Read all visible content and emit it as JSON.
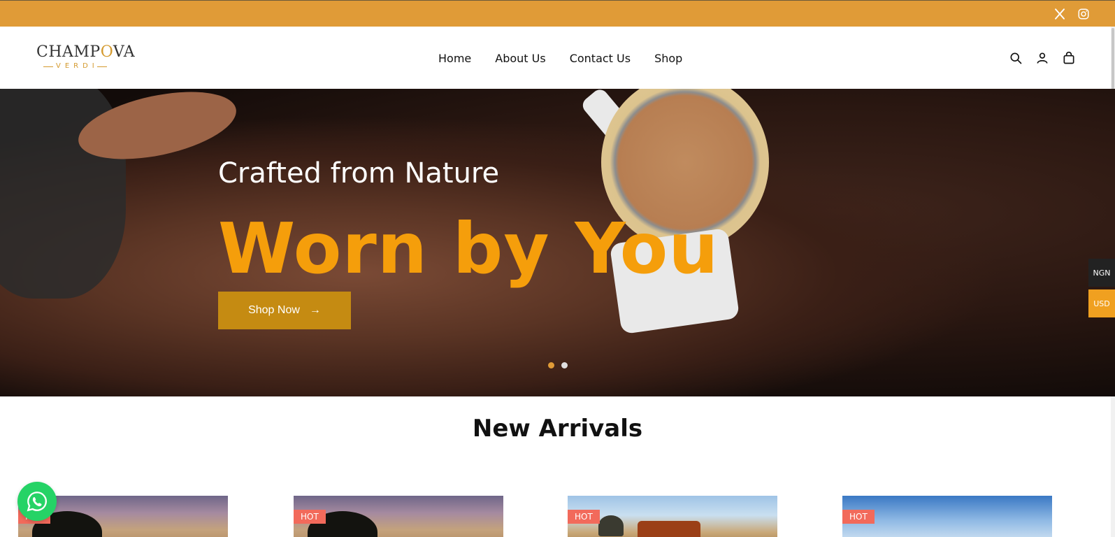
{
  "topbar": {
    "social": [
      {
        "name": "x-icon"
      },
      {
        "name": "instagram-icon"
      }
    ]
  },
  "brand": {
    "name_part1": "CHAMP",
    "name_o": "O",
    "name_part2": "VA",
    "sub": "VERDI"
  },
  "nav": {
    "items": [
      {
        "label": "Home"
      },
      {
        "label": "About Us"
      },
      {
        "label": "Contact Us"
      },
      {
        "label": "Shop"
      }
    ]
  },
  "header_icons": [
    "search-icon",
    "account-icon",
    "cart-icon"
  ],
  "hero": {
    "title": "Crafted from Nature",
    "headline": "Worn by You",
    "button_label": "Shop Now",
    "button_arrow": "→",
    "slides": 2,
    "active_slide": 1
  },
  "currency": {
    "options": [
      "NGN",
      "USD"
    ],
    "selected": "USD"
  },
  "new_arrivals": {
    "title": "New Arrivals",
    "products": [
      {
        "badge": "HOT"
      },
      {
        "badge": "HOT"
      },
      {
        "badge": "HOT"
      },
      {
        "badge": "HOT"
      }
    ]
  },
  "colors": {
    "topbar": "#e09b37",
    "accent": "#f59e0b",
    "button": "#c58b12",
    "badge": "#f26a5b",
    "whatsapp": "#25d366"
  }
}
